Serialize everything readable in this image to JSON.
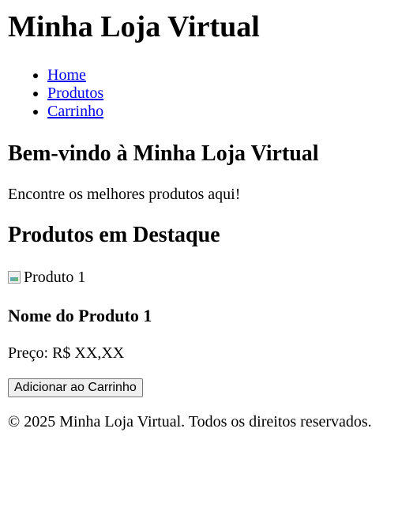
{
  "header": {
    "title": "Minha Loja Virtual"
  },
  "nav": {
    "items": [
      {
        "label": "Home"
      },
      {
        "label": "Produtos"
      },
      {
        "label": "Carrinho"
      }
    ]
  },
  "hero": {
    "heading": "Bem-vindo à Minha Loja Virtual",
    "tagline": "Encontre os melhores produtos aqui!"
  },
  "featured": {
    "heading": "Produtos em Destaque",
    "product": {
      "image_alt": "Produto 1",
      "name": "Nome do Produto 1",
      "price": "Preço: R$ XX,XX",
      "button_label": "Adicionar ao Carrinho"
    }
  },
  "footer": {
    "text": "© 2025 Minha Loja Virtual. Todos os direitos reservados."
  },
  "colors": {
    "link": "#0000ee",
    "text": "#000000",
    "background": "#ffffff"
  },
  "icons": [
    "broken-image-icon"
  ]
}
